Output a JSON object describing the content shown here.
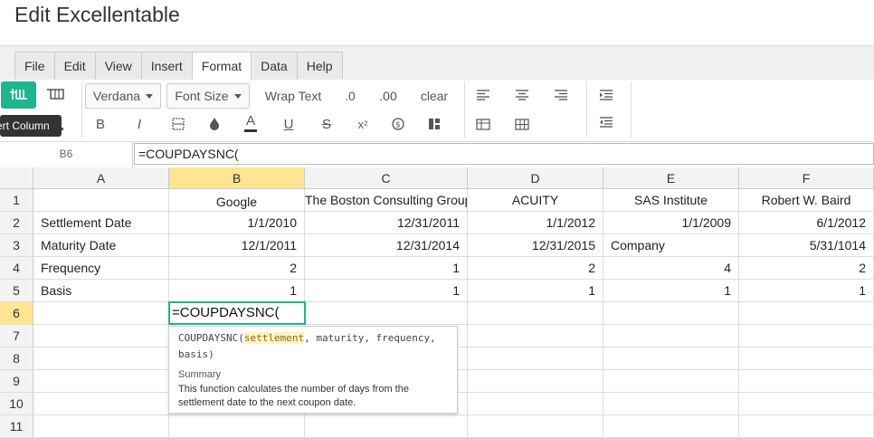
{
  "app": {
    "title": "Edit Excellentable"
  },
  "menus": [
    "File",
    "Edit",
    "View",
    "Insert",
    "Format",
    "Data",
    "Help"
  ],
  "active_menu": "Format",
  "toolbar": {
    "font": "Verdana",
    "font_size": "Font Size",
    "wrap_text": "Wrap Text",
    "dec_decrease": ".0",
    "dec_increase": ".00",
    "clear": "clear",
    "tooltip": "Insert Column",
    "bold": "B",
    "italic": "I",
    "text_color_letter": "A",
    "underline": "U",
    "strike": "S",
    "superscript": "x²"
  },
  "formula_bar": {
    "cell_ref": "B6",
    "value": "=COUPDAYSNC("
  },
  "columns": [
    "A",
    "B",
    "C",
    "D",
    "E",
    "F"
  ],
  "selected_column": "B",
  "rows": [
    "1",
    "2",
    "3",
    "4",
    "5",
    "6",
    "7",
    "8",
    "9",
    "10",
    "11"
  ],
  "selected_row": "6",
  "cells": {
    "r1": [
      "",
      "Google",
      "The Boston Consulting Group",
      "ACUITY",
      "SAS Institute",
      "Robert W. Baird"
    ],
    "r2": [
      "Settlement Date",
      "1/1/2010",
      "12/31/2011",
      "1/1/2012",
      "1/1/2009",
      "6/1/2012"
    ],
    "r3": [
      "Maturity Date",
      "12/1/2011",
      "12/31/2014",
      "12/31/2015",
      "Company",
      "5/31/1014"
    ],
    "r4": [
      "Frequency",
      "2",
      "1",
      "2",
      "4",
      "2"
    ],
    "r5": [
      "Basis",
      "1",
      "1",
      "1",
      "1",
      "1"
    ]
  },
  "editor": {
    "value": "=COUPDAYSNC("
  },
  "autocomplete": {
    "fn": "COUPDAYSNC(",
    "arg_highlight": "settlement",
    "args_rest": ", maturity, frequency, basis)",
    "summary_label": "Summary",
    "summary": "This function calculates the number of days from the settlement date to the next coupon date."
  },
  "colors": {
    "accent": "#1cb58f",
    "selected_header": "#ffe591"
  }
}
